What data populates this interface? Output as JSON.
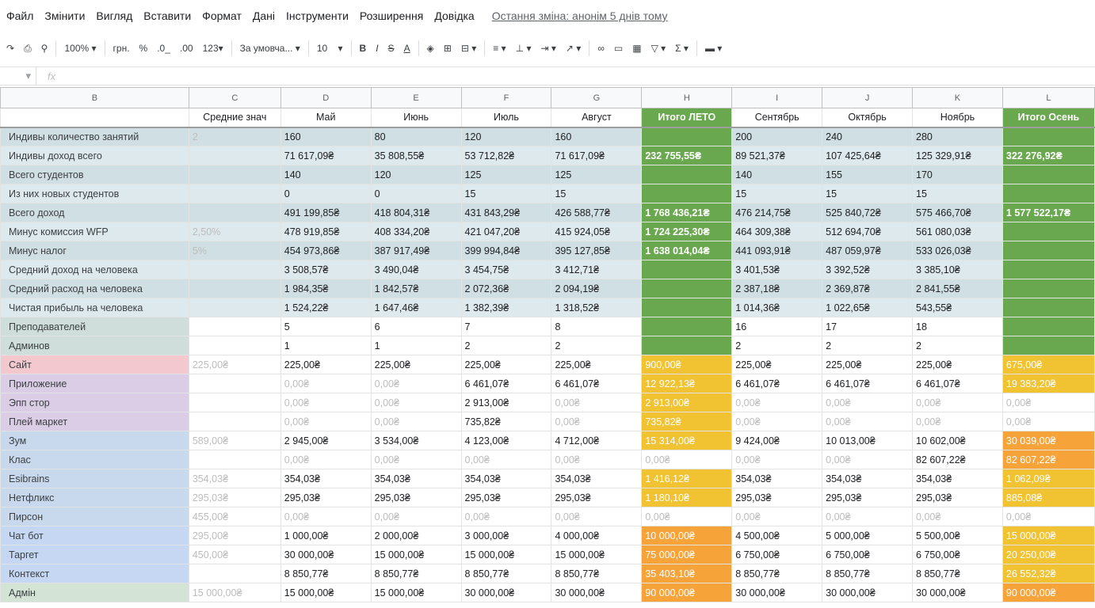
{
  "menu": {
    "items": [
      "Файл",
      "Змінити",
      "Вигляд",
      "Вставити",
      "Формат",
      "Дані",
      "Інструменти",
      "Розширення",
      "Довідка"
    ],
    "last_edit": "Остання зміна: анонім 5 днів тому"
  },
  "toolbar": {
    "zoom": "100%",
    "currency": "грн.",
    "percent": "%",
    "dec_less": ".0_",
    "dec_more": ".00",
    "more_formats": "123▾",
    "font": "За умовча...",
    "size": "10"
  },
  "formula_bar": {
    "fx": "fx"
  },
  "grid": {
    "column_letters": [
      "B",
      "C",
      "D",
      "E",
      "F",
      "G",
      "H",
      "I",
      "J",
      "K",
      "L"
    ],
    "headers": [
      "",
      "Средние знач",
      "Май",
      "Июнь",
      "Июль",
      "Август",
      "Итого ЛЕТО",
      "Сентябрь",
      "Октябрь",
      "Ноябрь",
      "Итого Осень"
    ],
    "rows": [
      {
        "label": "Индивы количество занятий",
        "bg": "#d0dfe3",
        "cells": [
          "2",
          "160",
          "80",
          "120",
          "160",
          "",
          "200",
          "240",
          "280",
          ""
        ]
      },
      {
        "label": "Индивы доход всего",
        "bg": "#dde9ed",
        "cells": [
          "",
          "71 617,09₴",
          "35 808,55₴",
          "53 712,82₴",
          "71 617,09₴",
          "232 755,55₴",
          "89 521,37₴",
          "107 425,64₴",
          "125 329,91₴",
          "322 276,92₴"
        ]
      },
      {
        "label": "Всего студентов",
        "bg": "#d0dfe3",
        "cells": [
          "",
          "140",
          "120",
          "125",
          "125",
          "",
          "140",
          "155",
          "170",
          ""
        ]
      },
      {
        "label": "Из них новых студентов",
        "bg": "#dde9ed",
        "cells": [
          "",
          "0",
          "0",
          "15",
          "15",
          "",
          "15",
          "15",
          "15",
          ""
        ]
      },
      {
        "label": "Всего доход",
        "bg": "#d0dfe3",
        "cells": [
          "",
          "491 199,85₴",
          "418 804,31₴",
          "431 843,29₴",
          "426 588,77₴",
          "1 768 436,21₴",
          "476 214,75₴",
          "525 840,72₴",
          "575 466,70₴",
          "1 577 522,17₴"
        ]
      },
      {
        "label": "Минус комиссия WFP",
        "bg": "#dde9ed",
        "cells": [
          "2,50%",
          "478 919,85₴",
          "408 334,20₴",
          "421 047,20₴",
          "415 924,05₴",
          "1 724 225,30₴",
          "464 309,38₴",
          "512 694,70₴",
          "561 080,03₴",
          ""
        ]
      },
      {
        "label": "Минус налог",
        "bg": "#d0dfe3",
        "cells": [
          "5%",
          "454 973,86₴",
          "387 917,49₴",
          "399 994,84₴",
          "395 127,85₴",
          "1 638 014,04₴",
          "441 093,91₴",
          "487 059,97₴",
          "533 026,03₴",
          ""
        ]
      },
      {
        "label": "Средний доход на человека",
        "bg": "#dde9ed",
        "cells": [
          "",
          "3 508,57₴",
          "3 490,04₴",
          "3 454,75₴",
          "3 412,71₴",
          "",
          "3 401,53₴",
          "3 392,52₴",
          "3 385,10₴",
          ""
        ]
      },
      {
        "label": "Средний расход на человека",
        "bg": "#d0dfe3",
        "cells": [
          "",
          "1 984,35₴",
          "1 842,57₴",
          "2 072,36₴",
          "2 094,19₴",
          "",
          "2 387,18₴",
          "2 369,87₴",
          "2 841,55₴",
          ""
        ]
      },
      {
        "label": "Чистая прибыль на человека",
        "bg": "#dde9ed",
        "cells": [
          "",
          "1 524,22₴",
          "1 647,46₴",
          "1 382,39₴",
          "1 318,52₴",
          "",
          "1 014,36₴",
          "1 022,65₴",
          "543,55₴",
          ""
        ]
      },
      {
        "label": "Преподавателей",
        "bg": "#cfdedb",
        "cells": [
          "",
          "5",
          "6",
          "7",
          "8",
          "",
          "16",
          "17",
          "18",
          ""
        ]
      },
      {
        "label": "Админов",
        "bg": "#cfdedb",
        "cells": [
          "",
          "1",
          "1",
          "2",
          "2",
          "",
          "2",
          "2",
          "2",
          ""
        ]
      },
      {
        "label": "Сайт",
        "bg": "#f3c9cf",
        "cells": [
          "225,00₴",
          "225,00₴",
          "225,00₴",
          "225,00₴",
          "225,00₴",
          "900,00₴",
          "225,00₴",
          "225,00₴",
          "225,00₴",
          "675,00₴"
        ]
      },
      {
        "label": "Приложение",
        "bg": "#dccde6",
        "cells": [
          "",
          "0,00₴",
          "0,00₴",
          "6 461,07₴",
          "6 461,07₴",
          "12 922,13₴",
          "6 461,07₴",
          "6 461,07₴",
          "6 461,07₴",
          "19 383,20₴"
        ]
      },
      {
        "label": "Эпп стор",
        "bg": "#dccde6",
        "cells": [
          "",
          "0,00₴",
          "0,00₴",
          "2 913,00₴",
          "0,00₴",
          "2 913,00₴",
          "0,00₴",
          "0,00₴",
          "0,00₴",
          "0,00₴"
        ]
      },
      {
        "label": "Плей маркет",
        "bg": "#dccde6",
        "cells": [
          "",
          "0,00₴",
          "0,00₴",
          "735,82₴",
          "0,00₴",
          "735,82₴",
          "0,00₴",
          "0,00₴",
          "0,00₴",
          "0,00₴"
        ]
      },
      {
        "label": "Зум",
        "bg": "#c8d9ee",
        "cells": [
          "589,00₴",
          "2 945,00₴",
          "3 534,00₴",
          "4 123,00₴",
          "4 712,00₴",
          "15 314,00₴",
          "9 424,00₴",
          "10 013,00₴",
          "10 602,00₴",
          "30 039,00₴"
        ]
      },
      {
        "label": "Клас",
        "bg": "#c8d9ee",
        "cells": [
          "",
          "0,00₴",
          "0,00₴",
          "0,00₴",
          "0,00₴",
          "0,00₴",
          "0,00₴",
          "0,00₴",
          "82 607,22₴",
          "82 607,22₴"
        ]
      },
      {
        "label": "Esibrains",
        "bg": "#c8d9ee",
        "cells": [
          "354,03₴",
          "354,03₴",
          "354,03₴",
          "354,03₴",
          "354,03₴",
          "1 416,12₴",
          "354,03₴",
          "354,03₴",
          "354,03₴",
          "1 062,09₴"
        ]
      },
      {
        "label": "Нетфликс",
        "bg": "#c8d9ee",
        "cells": [
          "295,03₴",
          "295,03₴",
          "295,03₴",
          "295,03₴",
          "295,03₴",
          "1 180,10₴",
          "295,03₴",
          "295,03₴",
          "295,03₴",
          "885,08₴"
        ]
      },
      {
        "label": "Пирсон",
        "bg": "#c8d9ee",
        "cells": [
          "455,00₴",
          "0,00₴",
          "0,00₴",
          "0,00₴",
          "0,00₴",
          "0,00₴",
          "0,00₴",
          "0,00₴",
          "0,00₴",
          "0,00₴"
        ]
      },
      {
        "label": "Чат бот",
        "bg": "#c5d7f2",
        "cells": [
          "295,00₴",
          "1 000,00₴",
          "2 000,00₴",
          "3 000,00₴",
          "4 000,00₴",
          "10 000,00₴",
          "4 500,00₴",
          "5 000,00₴",
          "5 500,00₴",
          "15 000,00₴"
        ]
      },
      {
        "label": "Таргет",
        "bg": "#c5d7f2",
        "cells": [
          "450,00₴",
          "30 000,00₴",
          "15 000,00₴",
          "15 000,00₴",
          "15 000,00₴",
          "75 000,00₴",
          "6 750,00₴",
          "6 750,00₴",
          "6 750,00₴",
          "20 250,00₴"
        ]
      },
      {
        "label": "Контекст",
        "bg": "#c5d7f2",
        "cells": [
          "",
          "8 850,77₴",
          "8 850,77₴",
          "8 850,77₴",
          "8 850,77₴",
          "35 403,10₴",
          "8 850,77₴",
          "8 850,77₴",
          "8 850,77₴",
          "26 552,32₴"
        ]
      },
      {
        "label": "Адмін",
        "bg": "#d3e3d6",
        "cells": [
          "15 000,00₴",
          "15 000,00₴",
          "15 000,00₴",
          "30 000,00₴",
          "30 000,00₴",
          "90 000,00₴",
          "30 000,00₴",
          "30 000,00₴",
          "30 000,00₴",
          "90 000,00₴"
        ]
      }
    ]
  },
  "colors": {
    "green": "#6aa84f",
    "yellow": "#f1c232",
    "orange": "#f6a33a",
    "deep_orange": "#f08b2e"
  },
  "highlights": {
    "H": [
      "g",
      "g",
      "g",
      "g",
      "g",
      "g",
      "g",
      "g",
      "g",
      "g",
      "g",
      "g",
      "y",
      "y",
      "y",
      "y",
      "y",
      "w",
      "y",
      "y",
      "w",
      "o",
      "o",
      "o",
      "o"
    ],
    "L": [
      "g",
      "g",
      "g",
      "g",
      "g",
      "g",
      "g",
      "g",
      "g",
      "g",
      "g",
      "g",
      "y",
      "y",
      "w",
      "w",
      "o",
      "o",
      "y",
      "y",
      "w",
      "y",
      "y",
      "y",
      "o"
    ]
  }
}
